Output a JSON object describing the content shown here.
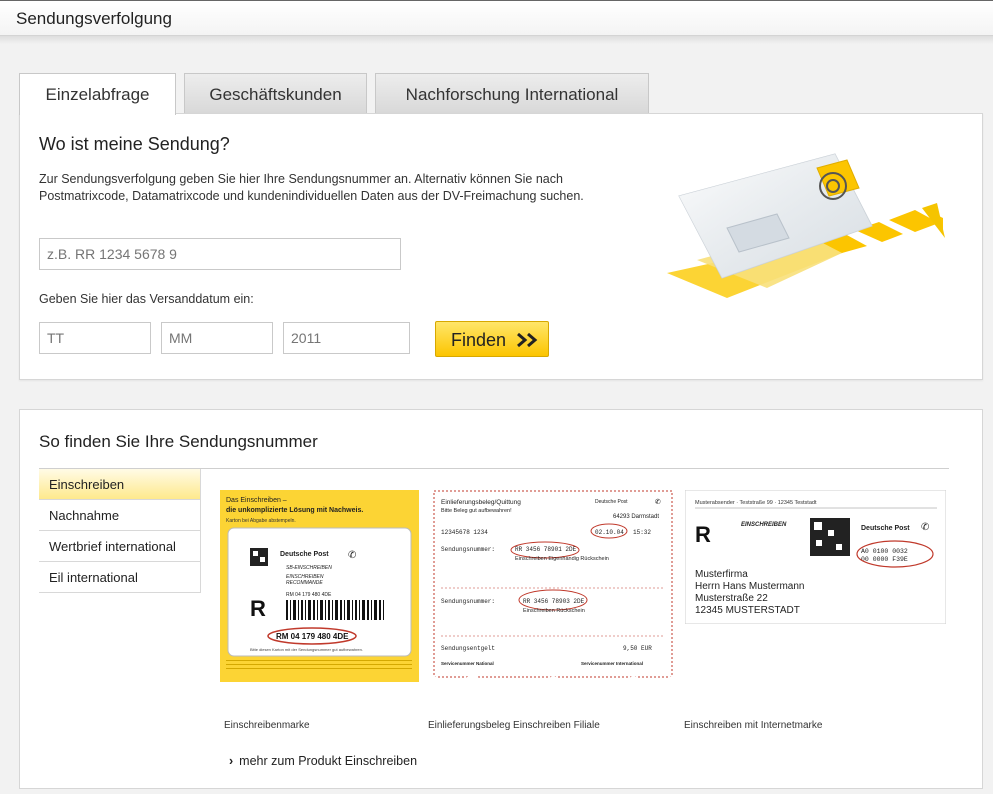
{
  "header": {
    "title": "Sendungsverfolgung"
  },
  "tabs": [
    {
      "label": "Einzelabfrage",
      "active": true
    },
    {
      "label": "Geschäftskunden",
      "active": false
    },
    {
      "label": "Nachforschung International",
      "active": false
    }
  ],
  "search": {
    "heading": "Wo ist meine Sendung?",
    "intro": "Zur Sendungsverfolgung geben Sie hier Ihre Sendungsnummer an. Alternativ können Sie nach Postmatrixcode, Datamatrixcode und kundenindividuellen Daten aus der DV-Freimachung suchen.",
    "number_placeholder": "z.B. RR 1234 5678 9",
    "date_label": "Geben Sie hier das Versanddatum ein:",
    "day_placeholder": "TT",
    "month_placeholder": "MM",
    "year_placeholder": "2011",
    "find_label": "Finden"
  },
  "howto": {
    "heading": "So finden Sie Ihre Sendungsnummer",
    "nav": [
      {
        "label": "Einschreiben",
        "active": true
      },
      {
        "label": "Nachnahme",
        "active": false
      },
      {
        "label": "Wertbrief international",
        "active": false
      },
      {
        "label": "Eil international",
        "active": false
      }
    ],
    "examples": [
      {
        "caption": "Einschreibenmarke",
        "header_line1": "Das Einschreiben –",
        "header_line2": "die unkomplizierte Lösung mit Nachweis.",
        "sub": "Karton bei Abgabe abstempeln.",
        "brand": "Deutsche Post",
        "label1": "SB-EINSCHREIBEN",
        "label2": "EINSCHREIBEN",
        "label3": "RECOMMANDE",
        "code_small": "RM 04 179 480 4DE",
        "letter": "R",
        "code_big": "RM 04 179 480 4DE",
        "footer": "Bitte diesen Karton mit der Sendungsnummer gut aufbewahren."
      },
      {
        "caption": "Einlieferungsbeleg Einschreiben Filiale",
        "title1": "Einlieferungsbeleg/Quittung",
        "title2": "Bitte Beleg gut aufbewahren!",
        "brand": "Deutsche Post",
        "place": "64293 Darmstadt",
        "ids": "12345678   1234",
        "date": "02.10.04",
        "time": "15:32",
        "row_label": "Sendungsnummer:",
        "num1": "RR 3456 78901 2DE",
        "type1": "Einschreiben Eigenhändig Rückschein",
        "num2": "RR 3456 78903 2DE",
        "type2": "Einschreiben Rückschein",
        "fee_label": "Sendungsentgelt",
        "fee": "9,50 EUR",
        "svc_nat": "Servicenummer National",
        "svc_int": "Servicenummer International"
      },
      {
        "caption": "Einschreiben mit Internetmarke",
        "sender": "Musterabsender · Teststraße 99 · 12345 Teststadt",
        "letter": "R",
        "label": "EINSCHREIBEN",
        "brand": "Deutsche Post",
        "code1": "A0 0100 0032",
        "code2": "00 0000 F39E",
        "addr1": "Musterfirma",
        "addr2": "Herrn Hans Mustermann",
        "addr3": "Musterstraße 22",
        "addr4": "12345 MUSTERSTADT"
      }
    ],
    "more_link": "mehr zum Produkt Einschreiben"
  },
  "colors": {
    "accent": "#fcc500",
    "accent_light": "#ffe66a",
    "circle": "#c0392b",
    "border": "#d6d6d6"
  }
}
